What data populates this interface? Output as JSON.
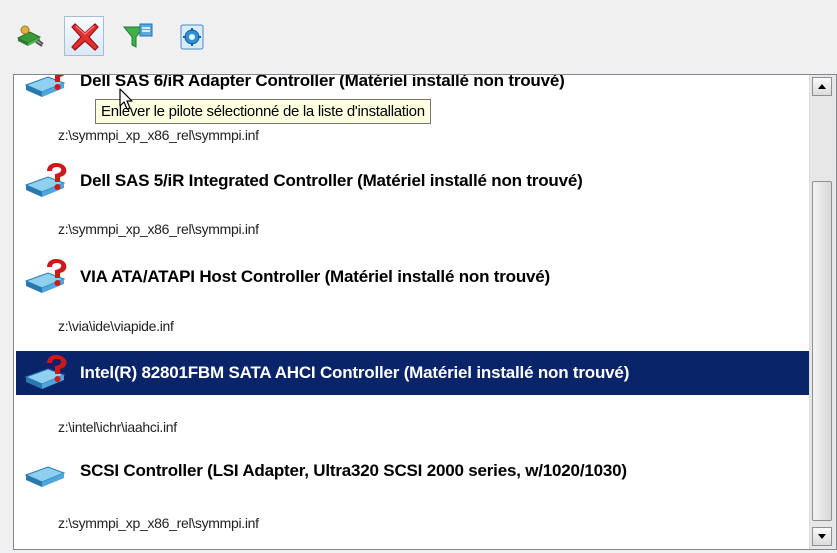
{
  "toolbar": {
    "buttons": [
      {
        "name": "add-driver-button",
        "icon": "add-driver-icon"
      },
      {
        "name": "remove-driver-button",
        "icon": "red-x-icon"
      },
      {
        "name": "filter-button",
        "icon": "filter-icon"
      },
      {
        "name": "settings-button",
        "icon": "gear-icon"
      }
    ]
  },
  "tooltip": {
    "text": "Enlever le pilote sélectionné de la liste d'installation"
  },
  "drivers": [
    {
      "title": "Dell SAS 6/iR Adapter Controller (Matériel installé non trouvé)",
      "path": "z:\\symmpi_xp_x86_rel\\symmpi.inf",
      "warning": true,
      "selected": false
    },
    {
      "title": "Dell SAS 5/iR Integrated Controller (Matériel installé non trouvé)",
      "path": "z:\\symmpi_xp_x86_rel\\symmpi.inf",
      "warning": true,
      "selected": false
    },
    {
      "title": "VIA ATA/ATAPI Host Controller (Matériel installé non trouvé)",
      "path": "z:\\via\\ide\\viapide.inf",
      "warning": true,
      "selected": false
    },
    {
      "title": "Intel(R) 82801FBM SATA AHCI Controller (Matériel installé non trouvé)",
      "path": "z:\\intel\\ichr\\iaahci.inf",
      "warning": true,
      "selected": true
    },
    {
      "title": "SCSI Controller (LSI Adapter, Ultra320 SCSI 2000 series, w/1020/1030)",
      "path": "z:\\symmpi_xp_x86_rel\\symmpi.inf",
      "warning": false,
      "selected": false
    }
  ],
  "colors": {
    "selection": "#0a246a",
    "tooltip_bg": "#ffffe1",
    "warning_red": "#d01818",
    "device_blue": "#3a8fc8"
  }
}
